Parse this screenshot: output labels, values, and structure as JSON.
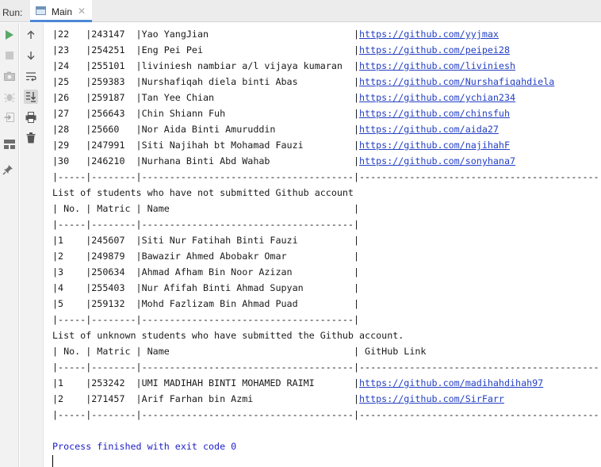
{
  "run_bar": {
    "label": "Run:",
    "tab_title": "Main",
    "close_glyph": "✕",
    "tab_icon": "console-window-icon"
  },
  "toolbar_icons": {
    "left": [
      "run-icon",
      "stop-icon",
      "camera-icon",
      "debug-icon",
      "exit-icon",
      "layout-icon",
      "pin-icon"
    ],
    "right": [
      "scroll-up-icon",
      "scroll-down-icon",
      "soft-wrap-icon",
      "scroll-to-end-icon",
      "print-icon",
      "trash-icon"
    ]
  },
  "colors": {
    "link": "#2440c4",
    "exit_text": "#1e1ec8",
    "run_green": "#59a869",
    "tab_accent": "#4d88d6"
  },
  "console": {
    "lines": [
      [
        "|22   |243147  |Yao YangJian                          |",
        {
          "link": "https://github.com/yyjmax"
        },
        "                      |"
      ],
      [
        "|23   |254251  |Eng Pei Pei                           |",
        {
          "link": "https://github.com/peipei28"
        },
        "                     |"
      ],
      [
        "|24   |255101  |liviniesh nambiar a/l vijaya kumaran  |",
        {
          "link": "https://github.com/liviniesh"
        },
        "                   |"
      ],
      [
        "|25   |259383  |Nurshafiqah diela binti Abas          |",
        {
          "link": "https://github.com/Nurshafiqahdiela"
        },
        "             |"
      ],
      [
        "|26   |259187  |Tan Yee Chian                         |",
        {
          "link": "https://github.com/ychian234"
        },
        "                    |"
      ],
      [
        "|27   |256643  |Chin Shiann Fuh                       |",
        {
          "link": "https://github.com/chinsfuh"
        },
        "                     |"
      ],
      [
        "|28   |25660   |Nor Aida Binti Amuruddin              |",
        {
          "link": "https://github.com/aida27"
        },
        "                      |"
      ],
      [
        "|29   |247991  |Siti Najihah bt Mohamad Fauzi         |",
        {
          "link": "https://github.com/najihahF"
        },
        "                    |"
      ],
      [
        "|30   |246210  |Nurhana Binti Abd Wahab               |",
        {
          "link": "https://github.com/sonyhana7"
        },
        "                    |"
      ],
      [
        "|-----|--------|--------------------------------------|---------------------------------------------|"
      ],
      [
        "List of students who have not submitted Github account"
      ],
      [
        "| No. | Matric | Name                                 |"
      ],
      [
        "|-----|--------|--------------------------------------|"
      ],
      [
        "|1    |245607  |Siti Nur Fatihah Binti Fauzi          |"
      ],
      [
        "|2    |249879  |Bawazir Ahmed Abobakr Omar            |"
      ],
      [
        "|3    |250634  |Ahmad Afham Bin Noor Azizan           |"
      ],
      [
        "|4    |255403  |Nur Afifah Binti Ahmad Supyan         |"
      ],
      [
        "|5    |259132  |Mohd Fazlizam Bin Ahmad Puad          |"
      ],
      [
        "|-----|--------|--------------------------------------|"
      ],
      [
        "List of unknown students who have submitted the Github account."
      ],
      [
        "| No. | Matric | Name                                 | GitHub Link                                 |"
      ],
      [
        "|-----|--------|--------------------------------------|---------------------------------------------|"
      ],
      [
        "|1    |253242  |UMI MADIHAH BINTI MOHAMED RAIMI       |",
        {
          "link": "https://github.com/madihahdihah97"
        },
        "              |"
      ],
      [
        "|2    |271457  |Arif Farhan bin Azmi                  |",
        {
          "link": "https://github.com/SirFarr"
        },
        "                     |"
      ],
      [
        "|-----|--------|--------------------------------------|---------------------------------------------|"
      ],
      [
        ""
      ],
      [
        {
          "blue": "Process finished with exit code 0"
        }
      ]
    ]
  }
}
